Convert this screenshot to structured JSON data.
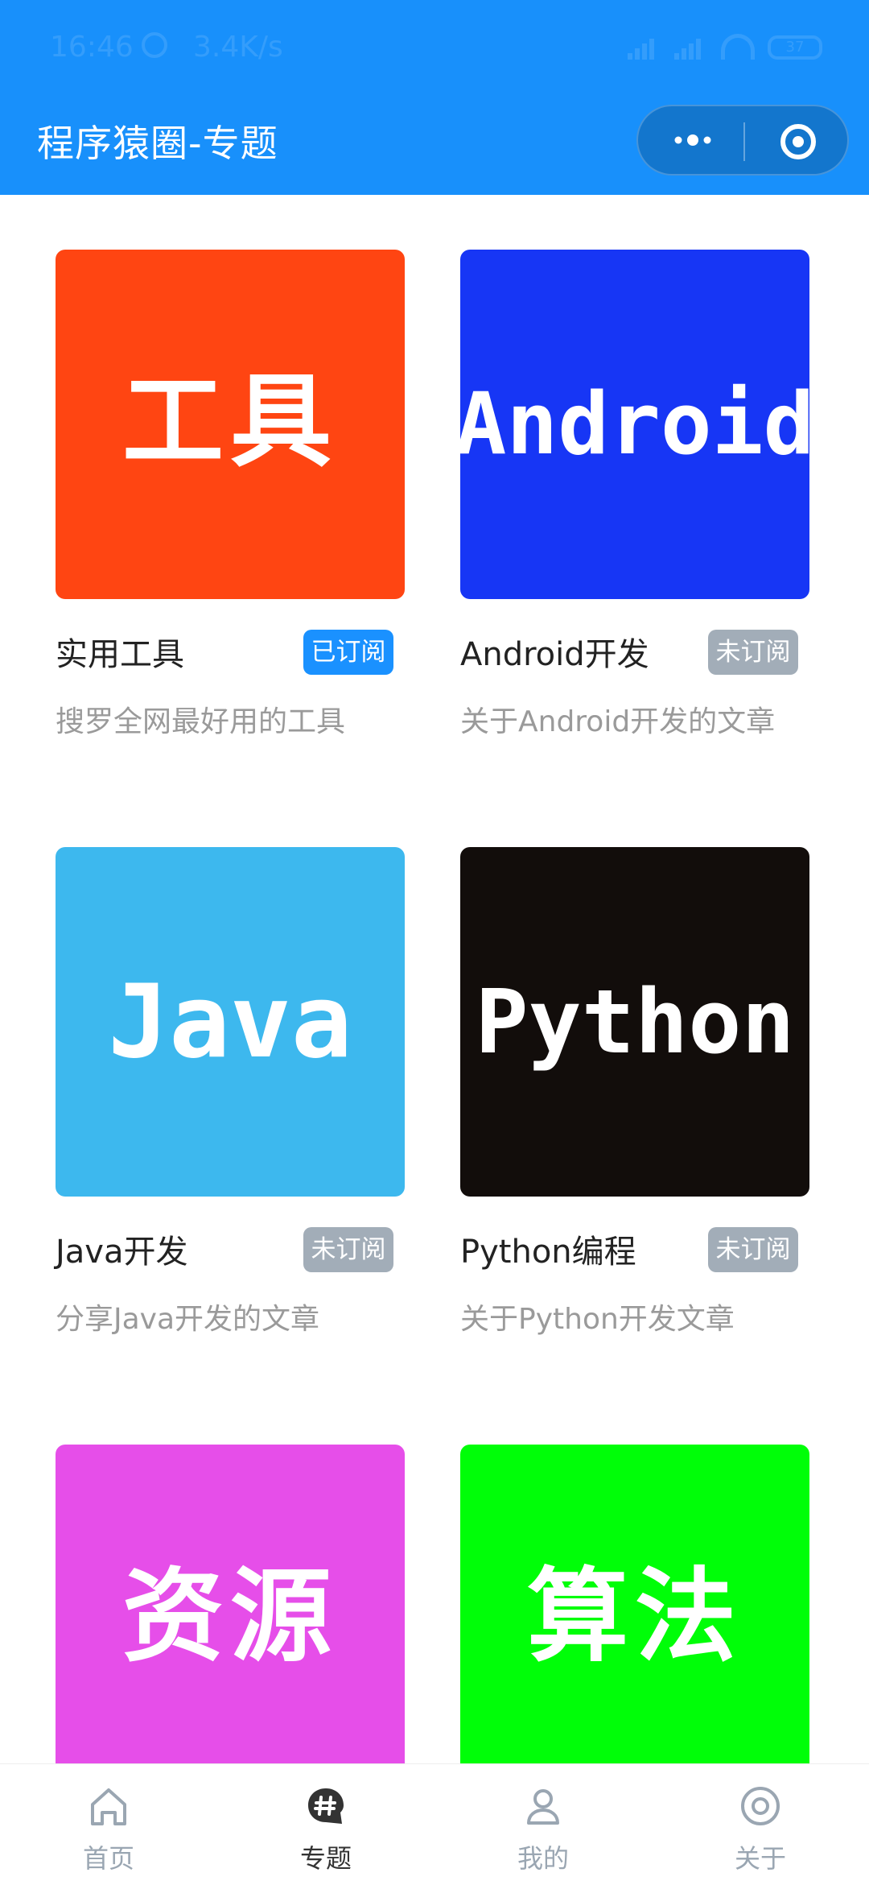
{
  "status_bar": {
    "time": "16:46",
    "speed": "3.4K/s",
    "battery": "37"
  },
  "header": {
    "title": "程序猿圈-专题",
    "more_icon": "more-dots-icon",
    "close_icon": "target-close-icon",
    "background_color": "#1890fb"
  },
  "topics": [
    {
      "thumb_text": "工具",
      "thumb_color": "#ff4512",
      "title": "实用工具",
      "badge": "已订阅",
      "badge_color": "#1a91ff",
      "description": "搜罗全网最好用的工具"
    },
    {
      "thumb_text": "Android",
      "thumb_color": "#1736f5",
      "title": "Android开发",
      "badge": "未订阅",
      "badge_color": "#a2adb8",
      "description": "关于Android开发的文章"
    },
    {
      "thumb_text": "Java",
      "thumb_color": "#3db8ee",
      "title": "Java开发",
      "badge": "未订阅",
      "badge_color": "#a2adb8",
      "description": "分享Java开发的文章"
    },
    {
      "thumb_text": "Python",
      "thumb_color": "#120d0b",
      "title": "Python编程",
      "badge": "未订阅",
      "badge_color": "#a2adb8",
      "description": "关于Python开发文章"
    },
    {
      "thumb_text": "资源",
      "thumb_color": "#e64ee9",
      "title": "",
      "badge": "",
      "badge_color": "",
      "description": ""
    },
    {
      "thumb_text": "算法",
      "thumb_color": "#00fe08",
      "title": "",
      "badge": "",
      "badge_color": "",
      "description": ""
    }
  ],
  "tabbar": {
    "items": [
      {
        "label": "首页",
        "icon": "home-icon",
        "active": false
      },
      {
        "label": "专题",
        "icon": "topic-hashtag-icon",
        "active": true
      },
      {
        "label": "我的",
        "icon": "user-icon",
        "active": false
      },
      {
        "label": "关于",
        "icon": "about-target-icon",
        "active": false
      }
    ],
    "active_color": "#333333",
    "inactive_color": "#9aa6b2"
  }
}
